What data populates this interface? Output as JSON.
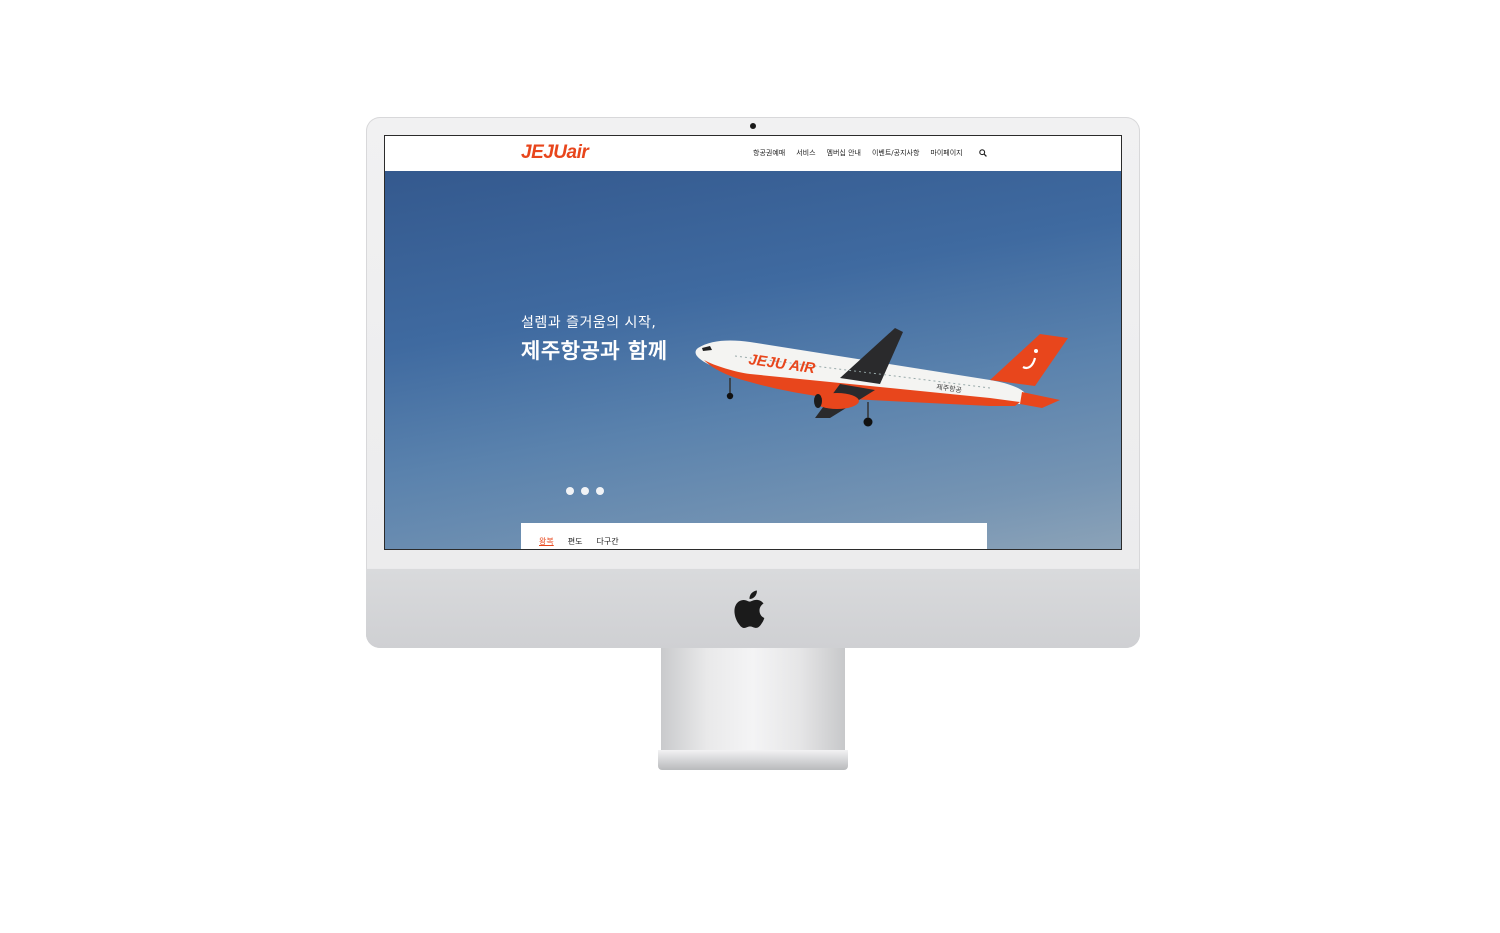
{
  "brand": {
    "logo_text": "JEJUair",
    "accent_color": "#e8461c"
  },
  "nav": {
    "items": [
      "항공권예매",
      "서비스",
      "멤버십 안내",
      "이벤트/공지사항",
      "마이페이지"
    ],
    "search_icon": "search-icon"
  },
  "hero": {
    "subtitle": "설렘과 즐거움의 시작,",
    "title": "제주항공과 함께",
    "plane_livery_text": "JEJU AIR",
    "plane_tail_korean": "제주항공",
    "slide_count": 3
  },
  "booking": {
    "tabs": [
      "왕복",
      "편도",
      "다구간"
    ],
    "active_tab": "왕복"
  },
  "device": {
    "type": "iMac",
    "logo_icon": "apple-icon"
  }
}
